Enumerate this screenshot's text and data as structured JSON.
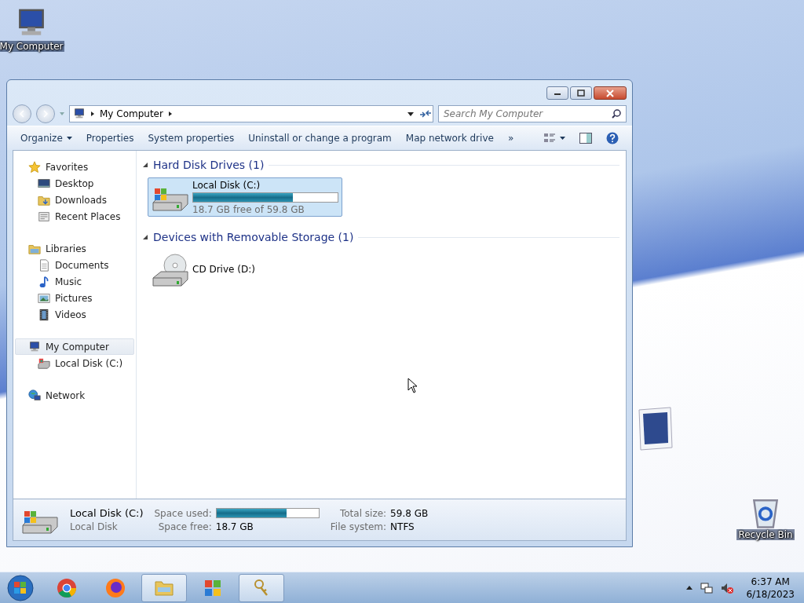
{
  "desktop_icons": [
    {
      "label": "My Computer",
      "kind": "computer"
    },
    {
      "label": "Recycle Bin",
      "kind": "recycle"
    }
  ],
  "window": {
    "address": {
      "path": [
        "My Computer"
      ]
    },
    "search": {
      "placeholder": "Search My Computer"
    },
    "toolbar": [
      {
        "label": "Organize",
        "kind": "menu"
      },
      {
        "label": "Properties",
        "kind": "button"
      },
      {
        "label": "System properties",
        "kind": "button"
      },
      {
        "label": "Uninstall or change a program",
        "kind": "button"
      },
      {
        "label": "Map network drive",
        "kind": "button"
      },
      {
        "label": "»",
        "kind": "more"
      }
    ],
    "nav": [
      {
        "label": "Favorites",
        "kind": "star",
        "selected": false,
        "children": [
          {
            "label": "Desktop",
            "kind": "desktop",
            "selected": false
          },
          {
            "label": "Downloads",
            "kind": "downloads",
            "selected": false
          },
          {
            "label": "Recent Places",
            "kind": "recent",
            "selected": false
          }
        ]
      },
      {
        "label": "Libraries",
        "kind": "library",
        "selected": false,
        "children": [
          {
            "label": "Documents",
            "kind": "documents",
            "selected": false
          },
          {
            "label": "Music",
            "kind": "music",
            "selected": false
          },
          {
            "label": "Pictures",
            "kind": "pictures",
            "selected": false
          },
          {
            "label": "Videos",
            "kind": "videos",
            "selected": false
          }
        ]
      },
      {
        "label": "My Computer",
        "kind": "computer",
        "selected": true,
        "children": [
          {
            "label": "Local Disk (C:)",
            "kind": "hdd",
            "selected": false
          }
        ]
      },
      {
        "label": "Network",
        "kind": "network",
        "selected": false
      }
    ],
    "sections": [
      {
        "title": "Hard Disk Drives (1)",
        "items": [
          {
            "name": "Local Disk (C:)",
            "kind": "hdd",
            "selected": true,
            "level": 0.69,
            "free": "18.7 GB free of 59.8 GB"
          }
        ]
      },
      {
        "title": "Devices with Removable Storage (1)",
        "items": [
          {
            "name": "CD Drive (D:)",
            "kind": "cd",
            "selected": false
          }
        ]
      }
    ],
    "details": {
      "name": "Local Disk (C:)",
      "type": "Local Disk",
      "used_label": "Space used:",
      "level": 0.69,
      "free_label": "Space free:",
      "free": "18.7 GB",
      "total_label": "Total size:",
      "total": "59.8 GB",
      "fs_label": "File system:",
      "fs": "NTFS"
    }
  },
  "taskbar": {
    "items": [
      {
        "kind": "chrome",
        "active": false
      },
      {
        "kind": "firefox",
        "active": false
      },
      {
        "kind": "explorer",
        "active": true
      },
      {
        "kind": "windows",
        "active": false
      },
      {
        "kind": "keys",
        "active": true
      }
    ],
    "time": "6:37 AM",
    "date": "6/18/2023"
  }
}
